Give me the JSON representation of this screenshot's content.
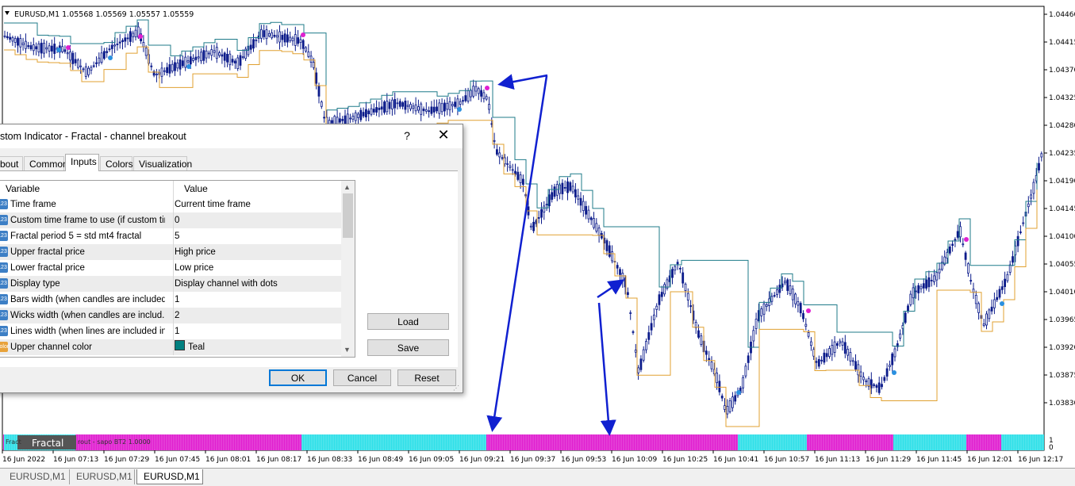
{
  "chart": {
    "header": "EURUSD,M1  1.05568 1.05569 1.05557 1.05559",
    "price_axis": [
      "1.04460",
      "1.04415",
      "1.04370",
      "1.04325",
      "1.04280",
      "1.04235",
      "1.04190",
      "1.04145",
      "1.04100",
      "1.04055",
      "1.04010",
      "1.03965",
      "1.03920",
      "1.03875",
      "1.03830"
    ],
    "indicator_axis": [
      "1",
      "0"
    ],
    "time_axis": [
      "16 Jun 2022",
      "16 Jun 07:13",
      "16 Jun 07:29",
      "16 Jun 07:45",
      "16 Jun 08:01",
      "16 Jun 08:17",
      "16 Jun 08:33",
      "16 Jun 08:49",
      "16 Jun 09:05",
      "16 Jun 09:21",
      "16 Jun 09:37",
      "16 Jun 09:53",
      "16 Jun 10:09",
      "16 Jun 10:25",
      "16 Jun 10:41",
      "16 Jun 10:57",
      "16 Jun 11:13",
      "16 Jun 11:29",
      "16 Jun 11:45",
      "16 Jun 12:01",
      "16 Jun 12:17"
    ],
    "indicator_label": "Fract",
    "indicator_label_rest": "rout - sapo BT2 1.0000",
    "indicator_tag": "Fractal",
    "colors": {
      "upper_channel": "#1f7b8a",
      "lower_channel": "#e0a030",
      "candle": "#0a1a8a",
      "dot_up": "#e020d0",
      "dot_down": "#2a90e0",
      "arrow": "#1020d0",
      "hist_up": "#e020d0",
      "hist_down": "#30e0e8"
    }
  },
  "chart_tabs": [
    "EURUSD,M1",
    "EURUSD,M1",
    "EURUSD,M1"
  ],
  "dialog": {
    "title": "ustom Indicator - Fractal - channel breakout",
    "help": "?",
    "close": "✕",
    "tabs": [
      "bout",
      "Common",
      "Inputs",
      "Colors",
      "Visualization"
    ],
    "active_tab": "Inputs",
    "columns": {
      "variable": "Variable",
      "value": "Value"
    },
    "rows": [
      {
        "icon": "123",
        "name": "Time frame",
        "value": "Current time frame"
      },
      {
        "icon": "123",
        "name": "Custom time frame to use (if custom tim...",
        "value": "0"
      },
      {
        "icon": "123",
        "name": "Fractal period 5 = std mt4 fractal",
        "value": "5"
      },
      {
        "icon": "123",
        "name": "Upper fractal price",
        "value": "High price"
      },
      {
        "icon": "123",
        "name": "Lower fractal price",
        "value": "Low price"
      },
      {
        "icon": "123",
        "name": "Display type",
        "value": "Display channel with dots"
      },
      {
        "icon": "123",
        "name": "Bars width (when candles are included...",
        "value": "1"
      },
      {
        "icon": "123",
        "name": "Wicks width (when candles are includ...",
        "value": "2"
      },
      {
        "icon": "123",
        "name": "Lines width (when lines are included in ...",
        "value": "1"
      },
      {
        "icon": "color",
        "name": "Upper channel color",
        "value": "Teal",
        "swatch": "#008080"
      }
    ],
    "side_buttons": {
      "load": "Load",
      "save": "Save"
    },
    "buttons": {
      "ok": "OK",
      "cancel": "Cancel",
      "reset": "Reset"
    }
  }
}
